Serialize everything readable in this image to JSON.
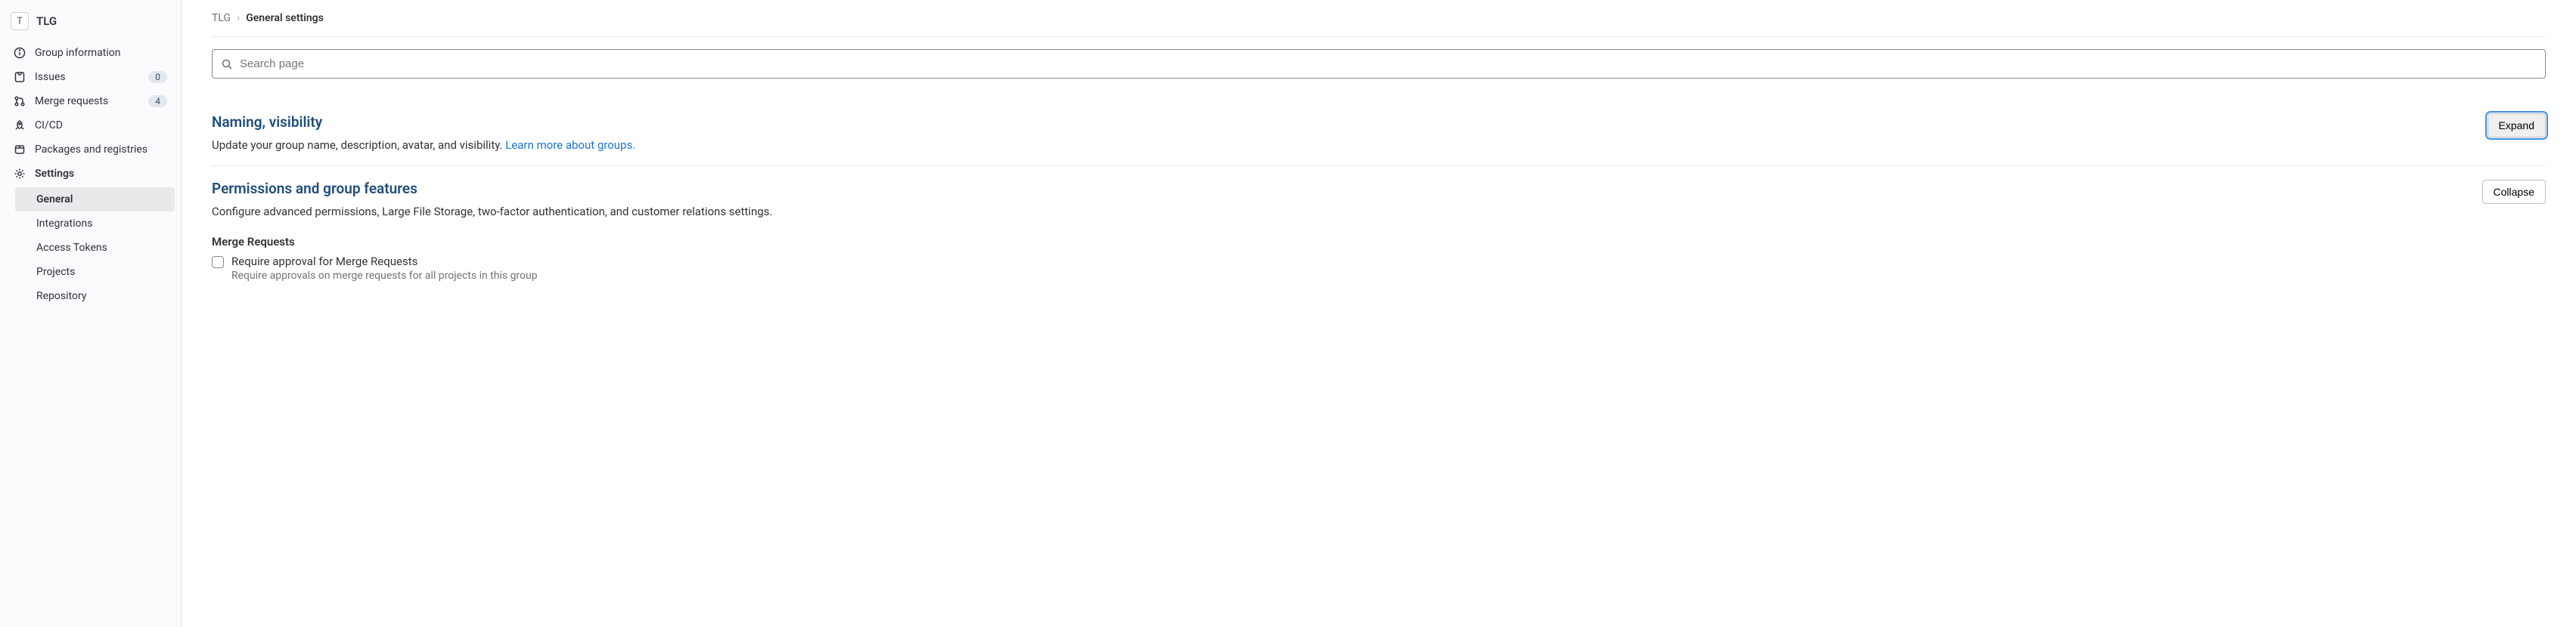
{
  "sidebar": {
    "avatar_letter": "T",
    "title": "TLG",
    "items": [
      {
        "label": "Group information",
        "badge": null
      },
      {
        "label": "Issues",
        "badge": "0"
      },
      {
        "label": "Merge requests",
        "badge": "4"
      },
      {
        "label": "CI/CD",
        "badge": null
      },
      {
        "label": "Packages and registries",
        "badge": null
      },
      {
        "label": "Settings",
        "badge": null
      }
    ],
    "settings_sub": [
      {
        "label": "General"
      },
      {
        "label": "Integrations"
      },
      {
        "label": "Access Tokens"
      },
      {
        "label": "Projects"
      },
      {
        "label": "Repository"
      }
    ]
  },
  "breadcrumb": {
    "parent": "TLG",
    "current": "General settings"
  },
  "search": {
    "placeholder": "Search page"
  },
  "sections": {
    "naming": {
      "title": "Naming, visibility",
      "desc": "Update your group name, description, avatar, and visibility. ",
      "link": "Learn more about groups.",
      "button": "Expand"
    },
    "permissions": {
      "title": "Permissions and group features",
      "desc": "Configure advanced permissions, Large File Storage, two-factor authentication, and customer relations settings.",
      "button": "Collapse",
      "merge_requests": {
        "heading": "Merge Requests",
        "checkbox_label": "Require approval for Merge Requests",
        "checkbox_help": "Require approvals on merge requests for all projects in this group"
      }
    }
  }
}
